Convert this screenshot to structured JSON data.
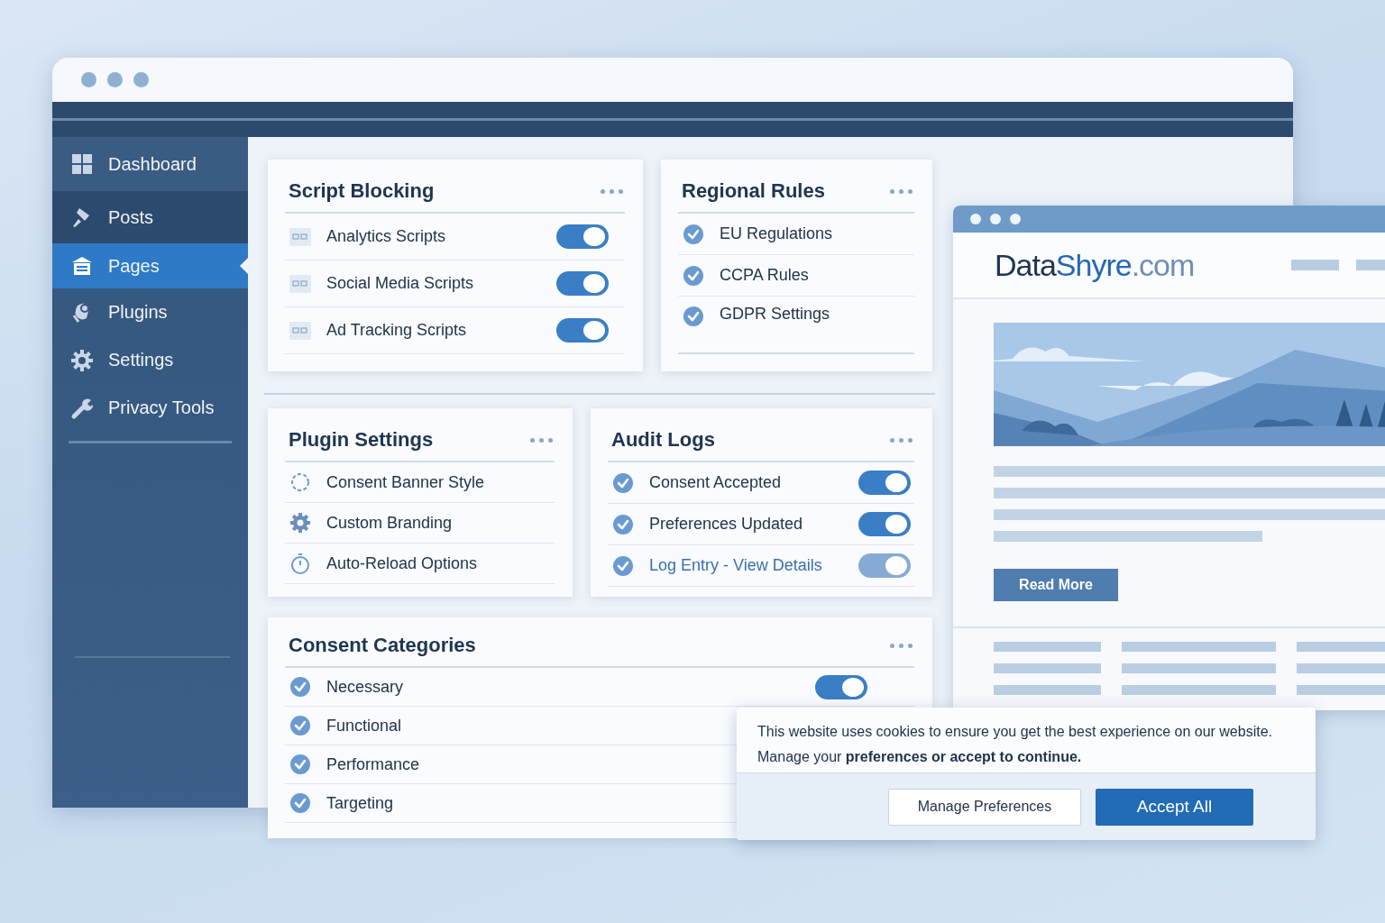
{
  "main_window": {
    "sidebar": [
      {
        "label": "Dashboard",
        "kind": "grid",
        "selected": false
      },
      {
        "label": "Posts",
        "kind": "pin",
        "selected": false
      },
      {
        "label": "Pages",
        "kind": "pages",
        "selected": true
      },
      {
        "label": "Plugins",
        "kind": "plug",
        "selected": false
      },
      {
        "label": "Settings",
        "kind": "gear",
        "selected": false
      },
      {
        "label": "Privacy Tools",
        "kind": "wrench",
        "selected": false
      }
    ],
    "cards": [
      {
        "title": "Script Blocking",
        "items": [
          {
            "label": "Analytics Scripts",
            "kind": "script",
            "toggle": {
              "on": true,
              "disabled": false
            }
          },
          {
            "label": "Social Media Scripts",
            "kind": "script",
            "toggle": {
              "on": true,
              "disabled": false
            }
          },
          {
            "label": "Ad Tracking Scripts",
            "kind": "script",
            "toggle": {
              "on": true,
              "disabled": false
            }
          }
        ]
      },
      {
        "title": "Regional Rules",
        "items": [
          {
            "label": "EU Regulations",
            "kind": "check"
          },
          {
            "label": "CCPA Rules",
            "kind": "check"
          },
          {
            "label": "GDPR Settings",
            "kind": "check"
          }
        ]
      },
      {
        "title": "Plugin Settings",
        "items": [
          {
            "label": "Consent Banner Style",
            "kind": "spinner"
          },
          {
            "label": "Custom Branding",
            "kind": "gear"
          },
          {
            "label": "Auto-Reload Options",
            "kind": "timer"
          }
        ]
      },
      {
        "title": "Audit Logs",
        "items": [
          {
            "label": "Consent Accepted",
            "kind": "check",
            "toggle": {
              "on": true,
              "disabled": false
            }
          },
          {
            "label": "Preferences Updated",
            "kind": "check",
            "toggle": {
              "on": true,
              "disabled": false
            }
          },
          {
            "label": "Log Entry - View Details",
            "kind": "check",
            "link": true,
            "toggle": {
              "on": true,
              "disabled": true
            }
          }
        ]
      },
      {
        "title": "Consent Categories",
        "items": [
          {
            "label": "Necessary",
            "kind": "check",
            "toggle": {
              "on": true,
              "disabled": false
            }
          },
          {
            "label": "Functional",
            "kind": "check"
          },
          {
            "label": "Performance",
            "kind": "check"
          },
          {
            "label": "Targeting",
            "kind": "check"
          }
        ]
      }
    ]
  },
  "preview_window": {
    "logo": [
      "Data",
      "Shyre",
      ".com"
    ],
    "button": "Read More",
    "image": {
      "kind": "picture"
    }
  },
  "cookie_banner": {
    "lines": [
      "This website uses cookies to ensure you get the best experience on our website.",
      "Manage your **preferences or accept to continue.**"
    ],
    "buttons": [
      {
        "label": "Manage Preferences",
        "kind": "secondary"
      },
      {
        "label": "Accept All",
        "kind": "primary"
      }
    ]
  }
}
